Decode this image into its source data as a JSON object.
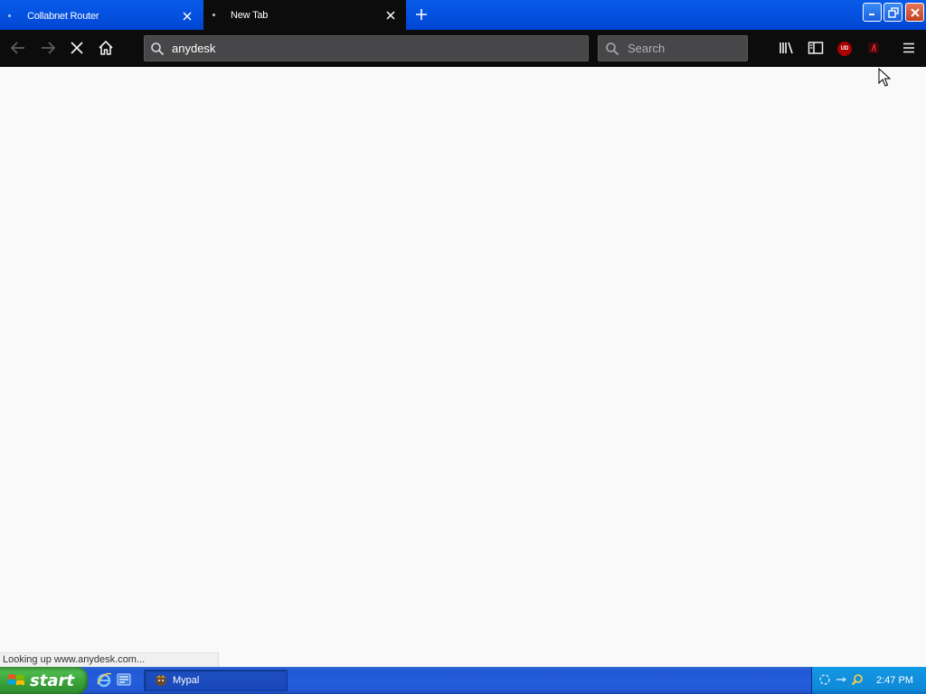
{
  "window": {
    "tabs": [
      {
        "label": "Collabnet Router",
        "active": false
      },
      {
        "label": "New Tab",
        "active": true
      }
    ]
  },
  "toolbar": {
    "url_value": "anydesk",
    "search_placeholder": "Search",
    "reader_extension_badge": "UD"
  },
  "status": {
    "text": "Looking up www.anydesk.com..."
  },
  "taskbar": {
    "start_label": "start",
    "task_items": [
      {
        "label": "Mypal"
      }
    ],
    "clock": "2:47 PM"
  },
  "colors": {
    "titlebar_blue": "#0553e3",
    "toolbar_dark": "#0c0c0d",
    "taskbar_blue": "#245edb",
    "start_green": "#37a137",
    "tray_blue": "#0e8ad8"
  },
  "icons": [
    "back-icon",
    "forward-icon",
    "stop-icon",
    "home-icon",
    "search-icon",
    "library-icon",
    "sidebar-icon",
    "ublock-icon",
    "extension-icon",
    "menu-icon",
    "plus-icon",
    "close-icon",
    "windows-flag-icon",
    "ie-icon",
    "outlook-icon",
    "mypal-icon"
  ]
}
